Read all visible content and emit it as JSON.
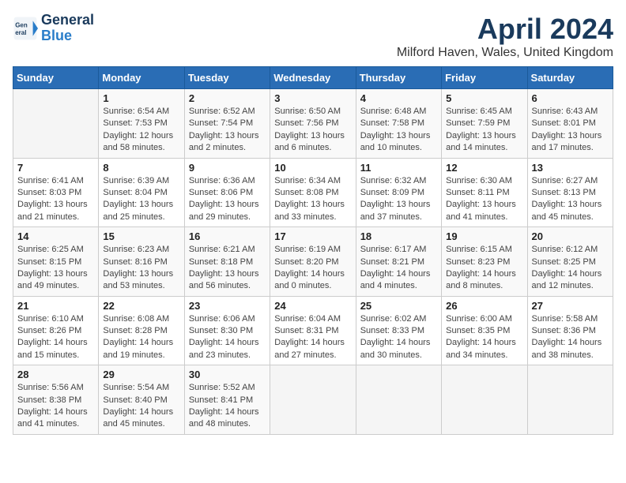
{
  "logo": {
    "line1": "General",
    "line2": "Blue"
  },
  "title": "April 2024",
  "subtitle": "Milford Haven, Wales, United Kingdom",
  "days_of_week": [
    "Sunday",
    "Monday",
    "Tuesday",
    "Wednesday",
    "Thursday",
    "Friday",
    "Saturday"
  ],
  "weeks": [
    [
      {
        "day": "",
        "info": ""
      },
      {
        "day": "1",
        "info": "Sunrise: 6:54 AM\nSunset: 7:53 PM\nDaylight: 12 hours\nand 58 minutes."
      },
      {
        "day": "2",
        "info": "Sunrise: 6:52 AM\nSunset: 7:54 PM\nDaylight: 13 hours\nand 2 minutes."
      },
      {
        "day": "3",
        "info": "Sunrise: 6:50 AM\nSunset: 7:56 PM\nDaylight: 13 hours\nand 6 minutes."
      },
      {
        "day": "4",
        "info": "Sunrise: 6:48 AM\nSunset: 7:58 PM\nDaylight: 13 hours\nand 10 minutes."
      },
      {
        "day": "5",
        "info": "Sunrise: 6:45 AM\nSunset: 7:59 PM\nDaylight: 13 hours\nand 14 minutes."
      },
      {
        "day": "6",
        "info": "Sunrise: 6:43 AM\nSunset: 8:01 PM\nDaylight: 13 hours\nand 17 minutes."
      }
    ],
    [
      {
        "day": "7",
        "info": "Sunrise: 6:41 AM\nSunset: 8:03 PM\nDaylight: 13 hours\nand 21 minutes."
      },
      {
        "day": "8",
        "info": "Sunrise: 6:39 AM\nSunset: 8:04 PM\nDaylight: 13 hours\nand 25 minutes."
      },
      {
        "day": "9",
        "info": "Sunrise: 6:36 AM\nSunset: 8:06 PM\nDaylight: 13 hours\nand 29 minutes."
      },
      {
        "day": "10",
        "info": "Sunrise: 6:34 AM\nSunset: 8:08 PM\nDaylight: 13 hours\nand 33 minutes."
      },
      {
        "day": "11",
        "info": "Sunrise: 6:32 AM\nSunset: 8:09 PM\nDaylight: 13 hours\nand 37 minutes."
      },
      {
        "day": "12",
        "info": "Sunrise: 6:30 AM\nSunset: 8:11 PM\nDaylight: 13 hours\nand 41 minutes."
      },
      {
        "day": "13",
        "info": "Sunrise: 6:27 AM\nSunset: 8:13 PM\nDaylight: 13 hours\nand 45 minutes."
      }
    ],
    [
      {
        "day": "14",
        "info": "Sunrise: 6:25 AM\nSunset: 8:15 PM\nDaylight: 13 hours\nand 49 minutes."
      },
      {
        "day": "15",
        "info": "Sunrise: 6:23 AM\nSunset: 8:16 PM\nDaylight: 13 hours\nand 53 minutes."
      },
      {
        "day": "16",
        "info": "Sunrise: 6:21 AM\nSunset: 8:18 PM\nDaylight: 13 hours\nand 56 minutes."
      },
      {
        "day": "17",
        "info": "Sunrise: 6:19 AM\nSunset: 8:20 PM\nDaylight: 14 hours\nand 0 minutes."
      },
      {
        "day": "18",
        "info": "Sunrise: 6:17 AM\nSunset: 8:21 PM\nDaylight: 14 hours\nand 4 minutes."
      },
      {
        "day": "19",
        "info": "Sunrise: 6:15 AM\nSunset: 8:23 PM\nDaylight: 14 hours\nand 8 minutes."
      },
      {
        "day": "20",
        "info": "Sunrise: 6:12 AM\nSunset: 8:25 PM\nDaylight: 14 hours\nand 12 minutes."
      }
    ],
    [
      {
        "day": "21",
        "info": "Sunrise: 6:10 AM\nSunset: 8:26 PM\nDaylight: 14 hours\nand 15 minutes."
      },
      {
        "day": "22",
        "info": "Sunrise: 6:08 AM\nSunset: 8:28 PM\nDaylight: 14 hours\nand 19 minutes."
      },
      {
        "day": "23",
        "info": "Sunrise: 6:06 AM\nSunset: 8:30 PM\nDaylight: 14 hours\nand 23 minutes."
      },
      {
        "day": "24",
        "info": "Sunrise: 6:04 AM\nSunset: 8:31 PM\nDaylight: 14 hours\nand 27 minutes."
      },
      {
        "day": "25",
        "info": "Sunrise: 6:02 AM\nSunset: 8:33 PM\nDaylight: 14 hours\nand 30 minutes."
      },
      {
        "day": "26",
        "info": "Sunrise: 6:00 AM\nSunset: 8:35 PM\nDaylight: 14 hours\nand 34 minutes."
      },
      {
        "day": "27",
        "info": "Sunrise: 5:58 AM\nSunset: 8:36 PM\nDaylight: 14 hours\nand 38 minutes."
      }
    ],
    [
      {
        "day": "28",
        "info": "Sunrise: 5:56 AM\nSunset: 8:38 PM\nDaylight: 14 hours\nand 41 minutes."
      },
      {
        "day": "29",
        "info": "Sunrise: 5:54 AM\nSunset: 8:40 PM\nDaylight: 14 hours\nand 45 minutes."
      },
      {
        "day": "30",
        "info": "Sunrise: 5:52 AM\nSunset: 8:41 PM\nDaylight: 14 hours\nand 48 minutes."
      },
      {
        "day": "",
        "info": ""
      },
      {
        "day": "",
        "info": ""
      },
      {
        "day": "",
        "info": ""
      },
      {
        "day": "",
        "info": ""
      }
    ]
  ]
}
